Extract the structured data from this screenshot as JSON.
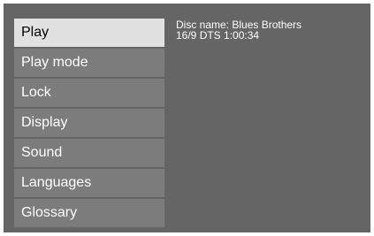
{
  "menu": {
    "items": [
      {
        "label": "Play",
        "selected": true
      },
      {
        "label": "Play mode",
        "selected": false
      },
      {
        "label": "Lock",
        "selected": false
      },
      {
        "label": "Display",
        "selected": false
      },
      {
        "label": "Sound",
        "selected": false
      },
      {
        "label": "Languages",
        "selected": false
      },
      {
        "label": "Glossary",
        "selected": false
      }
    ]
  },
  "info": {
    "disc_name": "Disc name: Blues Brothers",
    "details": "16/9 DTS 1:00:34"
  },
  "colors": {
    "background": "#656565",
    "item": "#7c7c7c",
    "item_selected": "#e1e1e1",
    "text": "#ffffff",
    "text_selected": "#000000"
  }
}
